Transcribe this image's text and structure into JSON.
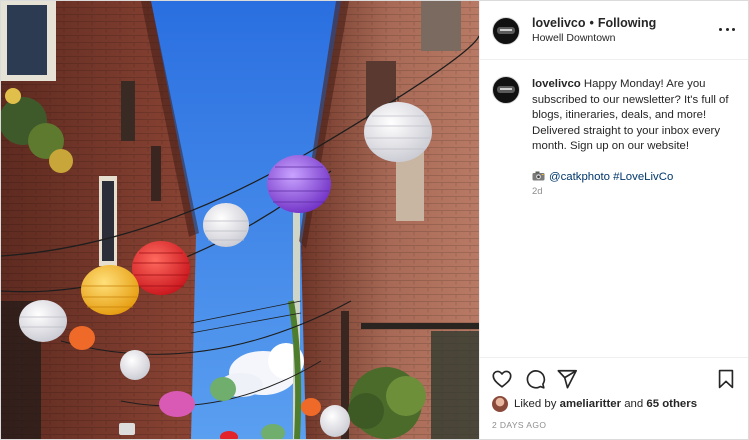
{
  "post": {
    "username": "lovelivco",
    "separator": "•",
    "follow_status": "Following",
    "location": "Howell Downtown",
    "more_icon": "more-horizontal-icon",
    "caption": {
      "username": "lovelivco",
      "text": "Happy Monday! Are you subscribed to our newsletter? It's full of blogs, itineraries, deals, and more! Delivered straight to your inbox every month. Sign up on our website!",
      "camera_icon": "camera-icon",
      "mention": "@catkphoto",
      "hashtag": "#LoveLivCo",
      "relative_time": "2d"
    },
    "actions": {
      "like_icon": "heart-icon",
      "comment_icon": "comment-icon",
      "share_icon": "share-icon",
      "save_icon": "bookmark-icon"
    },
    "likes": {
      "prefix": "Liked by",
      "user": "ameliaritter",
      "conjunction": "and",
      "others": "65 others"
    },
    "date": "2 DAYS AGO"
  },
  "colors": {
    "sky": "#2f7ae6",
    "brick_left": "#7a3a2c",
    "brick_right": "#9a5a48",
    "lantern_purple": "#8e4fd6",
    "lantern_red": "#e3242b",
    "lantern_yellow": "#f2b31b",
    "lantern_white": "#e9e9ef",
    "lantern_orange": "#ef6a28",
    "lantern_pink": "#d95ab4",
    "lantern_green": "#6fae6c",
    "link": "#00376b"
  }
}
